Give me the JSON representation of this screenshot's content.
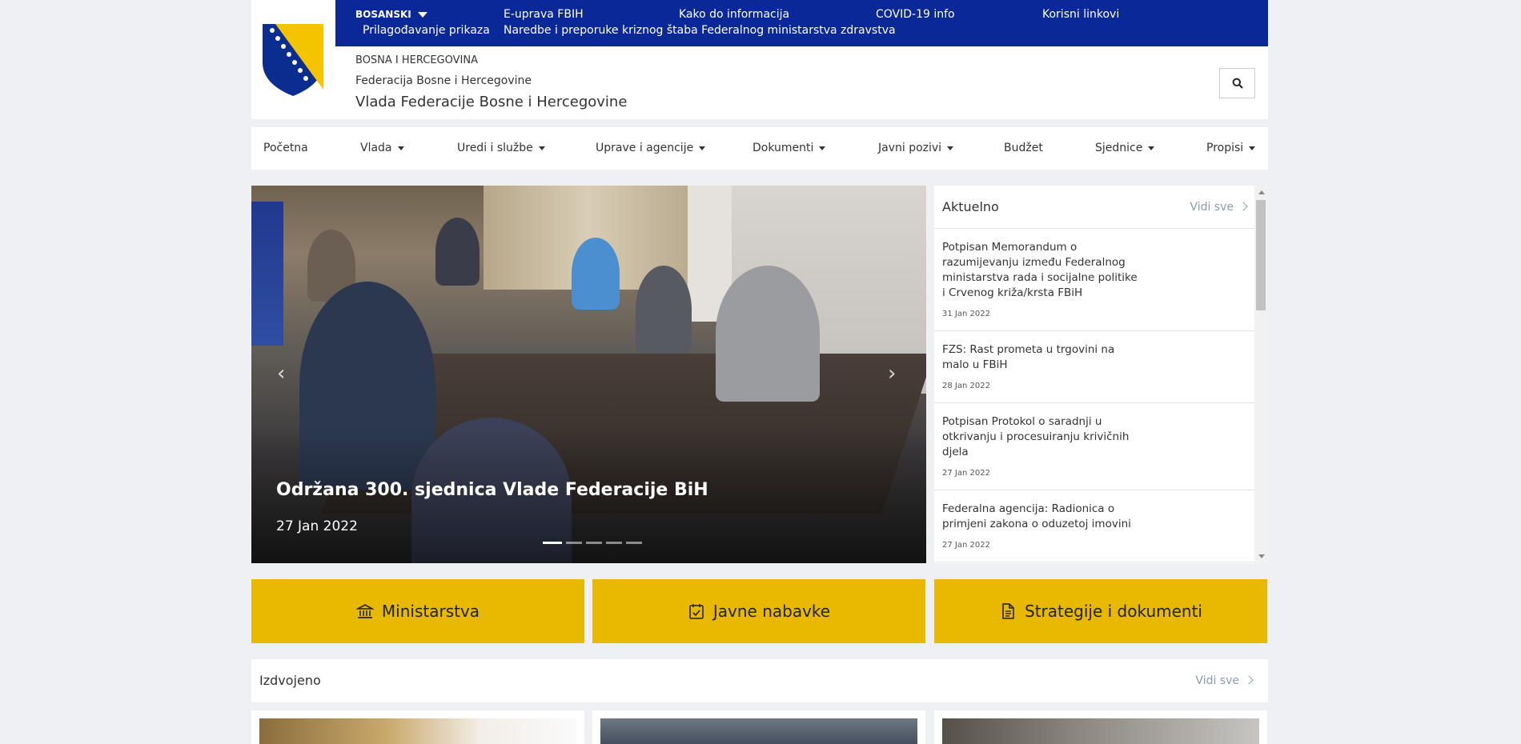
{
  "header": {
    "language": "BOSANSKI",
    "display_settings": "Prilagođavanje prikaza",
    "links": [
      "E-uprava FBIH",
      "Kako do informacija",
      "COVID-19 info",
      "Korisni linkovi"
    ],
    "covid_link": "Naredbe i preporuke kriznog štaba Federalnog ministarstva zdravstva",
    "org_line1": "BOSNA I HERCEGOVINA",
    "org_line2": "Federacija Bosne i Hercegovine",
    "org_line3": "Vlada Federacije Bosne i Hercegovine",
    "search_icon": "search-icon"
  },
  "nav": [
    {
      "label": "Početna",
      "dropdown": false
    },
    {
      "label": "Vlada",
      "dropdown": true
    },
    {
      "label": "Uredi i službe",
      "dropdown": true
    },
    {
      "label": "Uprave i agencije",
      "dropdown": true
    },
    {
      "label": "Dokumenti",
      "dropdown": true
    },
    {
      "label": "Javni pozivi",
      "dropdown": true
    },
    {
      "label": "Budžet",
      "dropdown": false
    },
    {
      "label": "Sjednice",
      "dropdown": true
    },
    {
      "label": "Propisi",
      "dropdown": true
    }
  ],
  "hero": {
    "title": "Održana 300. sjednica Vlade Federacije BiH",
    "date": "27 Jan 2022",
    "slides": 5,
    "active_slide": 1
  },
  "aktuelno": {
    "title": "Aktuelno",
    "see_all": "Vidi sve",
    "items": [
      {
        "title": "Potpisan Memorandum o razumijevanju između Federalnog ministarstva rada i socijalne politike i Crvenog križa/krsta FBiH",
        "date": "31 Jan 2022"
      },
      {
        "title": "FZS: Rast prometa u trgovini na malo u FBiH",
        "date": "28 Jan 2022"
      },
      {
        "title": "Potpisan Protokol o saradnji u otkrivanju i procesuiranju krivičnih djela",
        "date": "27 Jan 2022"
      },
      {
        "title": "Federalna agencija: Radionica o primjeni zakona o oduzetoj imovini",
        "date": "27 Jan 2022"
      }
    ]
  },
  "tiles": [
    {
      "label": "Ministarstva",
      "icon": "bank-icon"
    },
    {
      "label": "Javne nabavke",
      "icon": "calendar-check-icon"
    },
    {
      "label": "Strategije i dokumenti",
      "icon": "document-icon"
    }
  ],
  "izdvojeno": {
    "title": "Izdvojeno",
    "see_all": "Vidi sve"
  },
  "colors": {
    "topbar": "#0b2898",
    "accent_yellow": "#e8b900",
    "link_muted": "#8a9bb5"
  }
}
